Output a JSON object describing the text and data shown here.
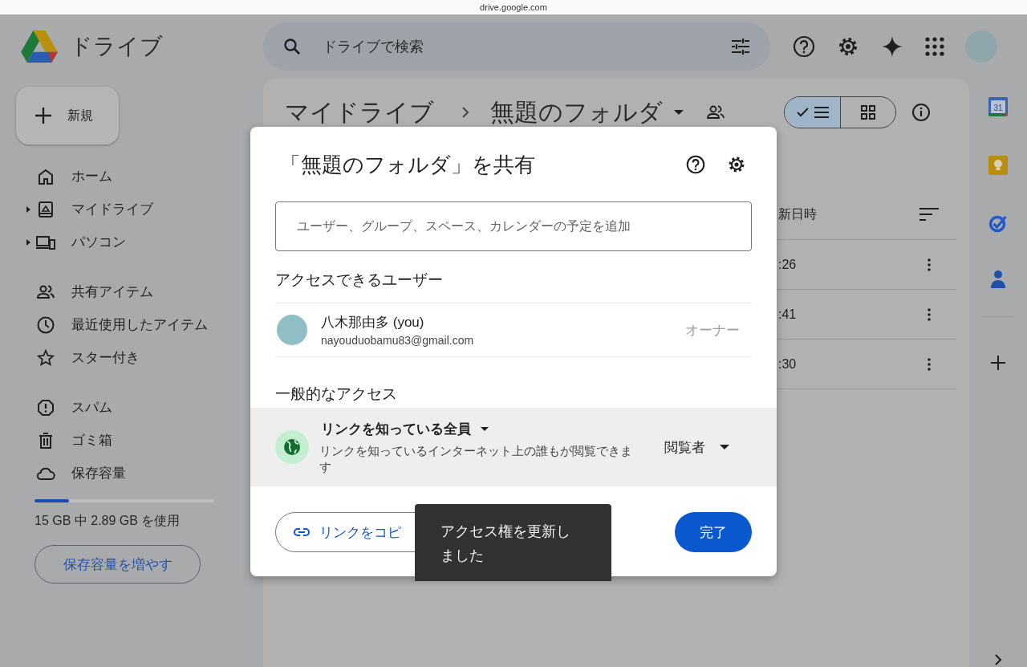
{
  "browser": {
    "url": "drive.google.com"
  },
  "app": {
    "name": "ドライブ"
  },
  "new_button": {
    "label": "新規"
  },
  "search": {
    "placeholder": "ドライブで検索"
  },
  "sidebar": {
    "groups": [
      {
        "items": [
          {
            "kind": "home",
            "label": "ホーム",
            "expandable": false
          },
          {
            "kind": "my-drive",
            "label": "マイドライブ",
            "expandable": true
          },
          {
            "kind": "computers",
            "label": "パソコン",
            "expandable": true
          }
        ]
      },
      {
        "items": [
          {
            "kind": "shared",
            "label": "共有アイテム",
            "expandable": false
          },
          {
            "kind": "recent",
            "label": "最近使用したアイテム",
            "expandable": false
          },
          {
            "kind": "starred",
            "label": "スター付き",
            "expandable": false
          }
        ]
      },
      {
        "items": [
          {
            "kind": "spam",
            "label": "スパム",
            "expandable": false
          },
          {
            "kind": "trash",
            "label": "ゴミ箱",
            "expandable": false
          },
          {
            "kind": "storage",
            "label": "保存容量",
            "expandable": false
          }
        ]
      }
    ]
  },
  "storage": {
    "level": 0.19,
    "usage": "15 GB 中 2.89 GB を使用",
    "button": "保存容量を増やす"
  },
  "breadcrumb": {
    "root": "マイドライブ",
    "current": "無題のフォルダ"
  },
  "view_toggle": [
    {
      "kind": "list",
      "selected": true
    },
    {
      "kind": "grid",
      "selected": false
    }
  ],
  "file_list": {
    "column": "新日時",
    "rows": [
      {
        "modified": ":26"
      },
      {
        "modified": ":41"
      },
      {
        "modified": ":30"
      }
    ]
  },
  "side_panel": {
    "calendar_day": "31"
  },
  "share_dialog": {
    "title": "「無題のフォルダ」を共有",
    "add_placeholder": "ユーザー、グループ、スペース、カレンダーの予定を追加",
    "people_heading": "アクセスできるユーザー",
    "users": [
      {
        "name": "八木那由多 (you)",
        "email": "nayouduobamu83@gmail.com",
        "role": "オーナー"
      }
    ],
    "general_heading": "一般的なアクセス",
    "general_access": {
      "scope": "リンクを知っている全員",
      "description": "リンクを知っているインターネット上の誰もが閲覧できます",
      "role": "閲覧者"
    },
    "copy_link": "リンクをコピ",
    "done": "完了"
  },
  "toast": {
    "message": "アクセス権を更新しました"
  }
}
